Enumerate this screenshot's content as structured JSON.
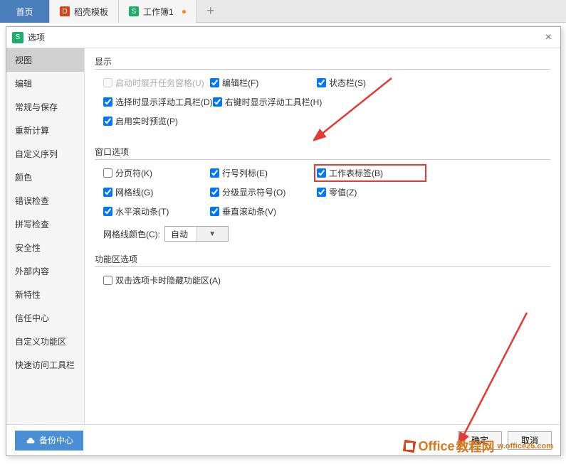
{
  "tabs": {
    "home": "首页",
    "doc1": "稻壳模板",
    "doc2": "工作簿1",
    "add": "+"
  },
  "dialog": {
    "title": "选项",
    "close": "×"
  },
  "sidebar": {
    "items": [
      "视图",
      "编辑",
      "常规与保存",
      "重新计算",
      "自定义序列",
      "颜色",
      "错误检查",
      "拼写检查",
      "安全性",
      "外部内容",
      "新特性",
      "信任中心",
      "自定义功能区",
      "快速访问工具栏"
    ]
  },
  "sections": {
    "display": {
      "title": "显示",
      "startup_pane": "启动时展开任务窗格(U)",
      "formula_bar": "编辑栏(F)",
      "status_bar": "状态栏(S)",
      "float_toolbar_select": "选择时显示浮动工具栏(D)",
      "float_toolbar_right": "右键时显示浮动工具栏(H)",
      "live_preview": "启用实时预览(P)"
    },
    "window": {
      "title": "窗口选项",
      "page_breaks": "分页符(K)",
      "row_col_headers": "行号列标(E)",
      "sheet_tabs": "工作表标签(B)",
      "gridlines": "网格线(G)",
      "outline_symbols": "分级显示符号(O)",
      "zero_values": "零值(Z)",
      "h_scroll": "水平滚动条(T)",
      "v_scroll": "垂直滚动条(V)",
      "grid_color_label": "网格线颜色(C):",
      "grid_color_value": "自动"
    },
    "ribbon": {
      "title": "功能区选项",
      "dblclick_hide": "双击选项卡时隐藏功能区(A)"
    }
  },
  "footer": {
    "backup": "备份中心",
    "ok": "确定",
    "cancel": "取消"
  },
  "watermark": {
    "text1": "Office",
    "text2": "教程网",
    "url": "w.office26.com"
  }
}
